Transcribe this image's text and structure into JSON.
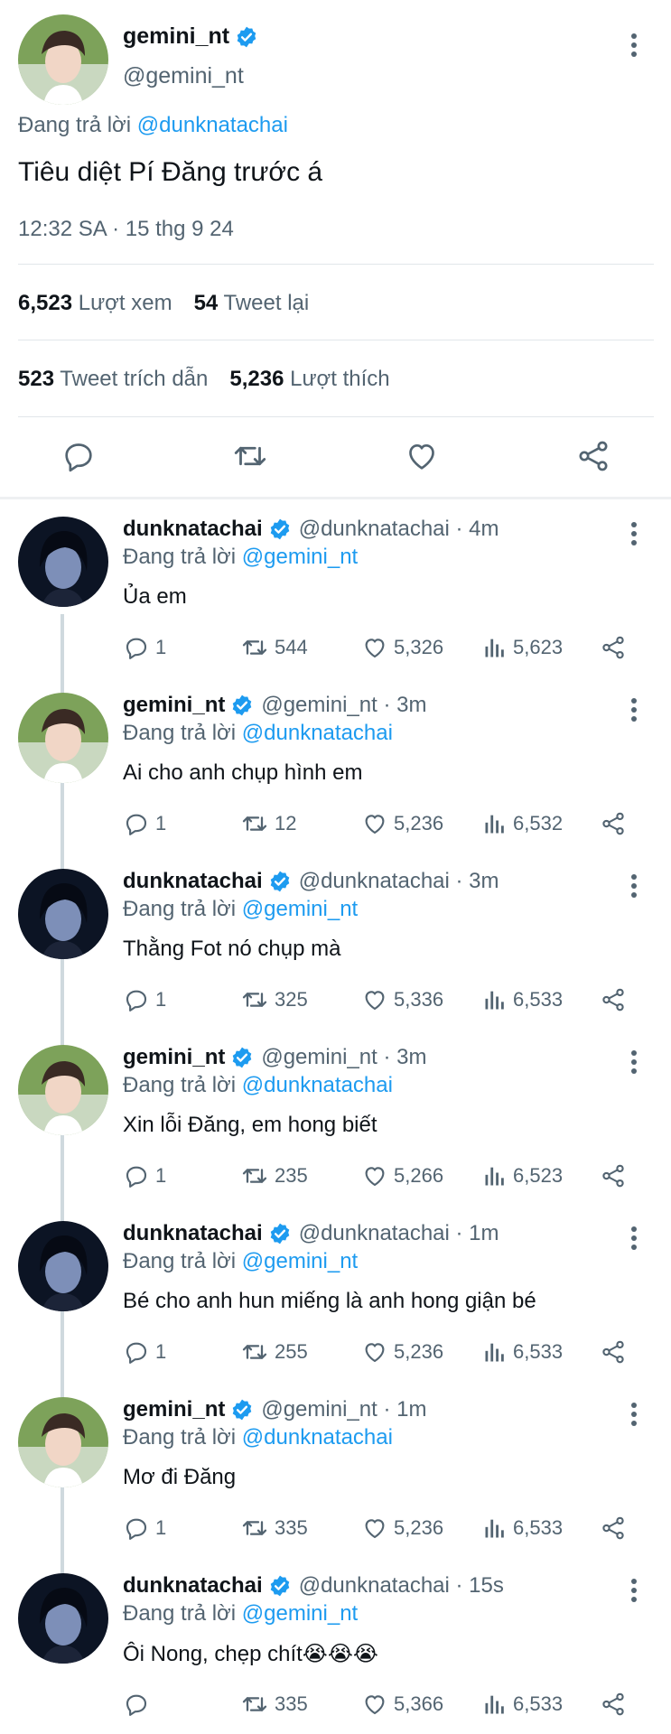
{
  "main_tweet": {
    "name": "gemini_nt",
    "handle": "@gemini_nt",
    "reply_prefix": "Đang trả lời",
    "reply_to": "@dunknatachai",
    "text": "Tiêu diệt Pí Đăng trước á",
    "timestamp": "12:32 SA · 15 thg 9 24",
    "views_count": "6,523",
    "views_label": "Lượt xem",
    "retweets_count": "54",
    "retweets_label": "Tweet lại",
    "quotes_count": "523",
    "quotes_label": "Tweet trích dẫn",
    "likes_count": "5,236",
    "likes_label": "Lượt thích"
  },
  "replies": [
    {
      "name": "dunknatachai",
      "handle": "@dunknatachai · 4m",
      "reply_prefix": "Đang trả lời",
      "reply_to": "@gemini_nt",
      "text": "Ủa em",
      "replies": "1",
      "retweets": "544",
      "likes": "5,326",
      "views": "5,623",
      "avatar": "dark"
    },
    {
      "name": "gemini_nt",
      "handle": "@gemini_nt · 3m",
      "reply_prefix": "Đang trả lời",
      "reply_to": "@dunknatachai",
      "text": "Ai cho anh chụp hình em",
      "replies": "1",
      "retweets": "12",
      "likes": "5,236",
      "views": "6,532",
      "avatar": "light"
    },
    {
      "name": "dunknatachai",
      "handle": "@dunknatachai · 3m",
      "reply_prefix": "Đang trả lời",
      "reply_to": "@gemini_nt",
      "text": "Thằng Fot nó chụp mà",
      "replies": "1",
      "retweets": "325",
      "likes": "5,336",
      "views": "6,533",
      "avatar": "dark"
    },
    {
      "name": "gemini_nt",
      "handle": "@gemini_nt · 3m",
      "reply_prefix": "Đang trả lời",
      "reply_to": "@dunknatachai",
      "text": "Xin lỗi Đăng, em hong biết",
      "replies": "1",
      "retweets": "235",
      "likes": "5,266",
      "views": "6,523",
      "avatar": "light"
    },
    {
      "name": "dunknatachai",
      "handle": "@dunknatachai · 1m",
      "reply_prefix": "Đang trả lời",
      "reply_to": "@gemini_nt",
      "text": "Bé cho anh hun miếng là anh hong giận bé",
      "replies": "1",
      "retweets": "255",
      "likes": "5,236",
      "views": "6,533",
      "avatar": "dark"
    },
    {
      "name": "gemini_nt",
      "handle": "@gemini_nt · 1m",
      "reply_prefix": "Đang trả lời",
      "reply_to": "@dunknatachai",
      "text": "Mơ đi Đăng",
      "replies": "1",
      "retweets": "335",
      "likes": "5,236",
      "views": "6,533",
      "avatar": "light"
    },
    {
      "name": "dunknatachai",
      "handle": "@dunknatachai · 15s",
      "reply_prefix": "Đang trả lời",
      "reply_to": "@gemini_nt",
      "text": "Ôi Nong, chẹp chít😭😭😭",
      "replies": "",
      "retweets": "335",
      "likes": "5,366",
      "views": "6,533",
      "avatar": "dark"
    }
  ],
  "icons": {
    "verified": "verified-badge-icon",
    "more": "more-vertical-icon",
    "reply": "reply-icon",
    "retweet": "retweet-icon",
    "like": "heart-icon",
    "views": "views-icon",
    "share": "share-icon"
  },
  "colors": {
    "accent": "#1d9bf0",
    "text": "#0f1419",
    "muted": "#536471",
    "divider": "#e1e6ea",
    "thread_line": "#cfd9de"
  }
}
